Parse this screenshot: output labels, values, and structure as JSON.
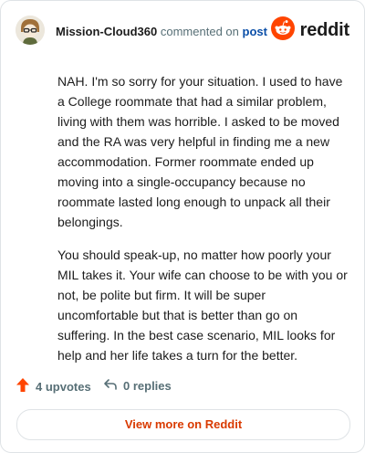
{
  "header": {
    "author": "Mission-Cloud360",
    "action_text": "commented on",
    "target_link": "post",
    "brand_name": "reddit"
  },
  "comment": {
    "paragraphs": [
      "NAH. I'm so sorry for your situation. I used to have a College roommate that had a similar problem, living with them was horrible. I asked to be moved and the RA was very helpful in finding me a new accommodation. Former roommate ended up moving into a single-occupancy because no roommate lasted long enough to unpack all their belongings.",
      "You should speak-up, no matter how poorly your MIL takes it. Your wife can choose to be with you or not, be polite but firm. It will be super uncomfortable but that is better than go on suffering. In the best case scenario, MIL looks for help and her life takes a turn for the better."
    ]
  },
  "footer": {
    "upvotes_label": "4 upvotes",
    "replies_label": "0 replies",
    "view_more_label": "View more on Reddit"
  },
  "colors": {
    "brand": "#ff4500",
    "upvote": "#ff4500",
    "link": "#0b4fa8",
    "cta": "#d93a00"
  },
  "icons": {
    "avatar": "avatar",
    "brand": "reddit-snoo-icon",
    "upvote": "upvote-arrow-icon",
    "replies": "reply-arrow-icon"
  }
}
